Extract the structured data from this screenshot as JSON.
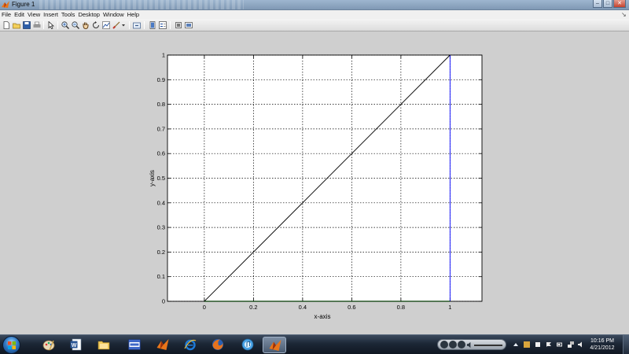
{
  "window": {
    "title": "Figure 1",
    "minimize_glyph": "–",
    "maximize_glyph": "□",
    "close_glyph": "✕"
  },
  "menubar": {
    "items": [
      "File",
      "Edit",
      "View",
      "Insert",
      "Tools",
      "Desktop",
      "Window",
      "Help"
    ],
    "grip": "↘"
  },
  "toolbar": {
    "icons": [
      "new-figure-icon",
      "open-file-icon",
      "save-icon",
      "print-icon",
      "select-arrow-icon",
      "zoom-in-icon",
      "zoom-out-icon",
      "pan-hand-icon",
      "rotate-3d-icon",
      "data-cursor-icon",
      "brush-icon",
      "link-plot-icon",
      "colorbar-icon",
      "legend-icon",
      "hide-plot-tools-icon",
      "show-plot-tools-icon"
    ]
  },
  "chart_data": {
    "type": "line",
    "xlabel": "x-axis",
    "ylabel": "y-axis",
    "xlim": [
      -0.15,
      1.13
    ],
    "ylim": [
      0,
      1
    ],
    "x_ticks": [
      "0",
      "0.2",
      "0.4",
      "0.6",
      "0.8",
      "1"
    ],
    "y_ticks": [
      "0",
      "0.1",
      "0.2",
      "0.3",
      "0.4",
      "0.5",
      "0.6",
      "0.7",
      "0.8",
      "0.9",
      "1"
    ],
    "grid": true,
    "series": [
      {
        "color": "#000000",
        "x": [
          0,
          1
        ],
        "y": [
          0,
          1
        ]
      },
      {
        "color": "#0000ff",
        "x": [
          1,
          1
        ],
        "y": [
          0,
          1
        ]
      },
      {
        "color": "#00cc00",
        "x": [
          0,
          1
        ],
        "y": [
          0,
          0
        ]
      }
    ]
  },
  "taskbar": {
    "apps": [
      "paint-icon",
      "word-icon",
      "file-explorer-icon",
      "quiz-app-icon",
      "matlab-icon",
      "internet-explorer-icon",
      "firefox-icon",
      "itunes-icon",
      "matlab-icon"
    ],
    "active_app_index": 8,
    "clock_time": "10:16 PM",
    "clock_date": "4/21/2012"
  },
  "colors": {
    "accent": "#3279c4",
    "axes_background": "#ffffff",
    "figure_background": "#cfcfcf"
  }
}
